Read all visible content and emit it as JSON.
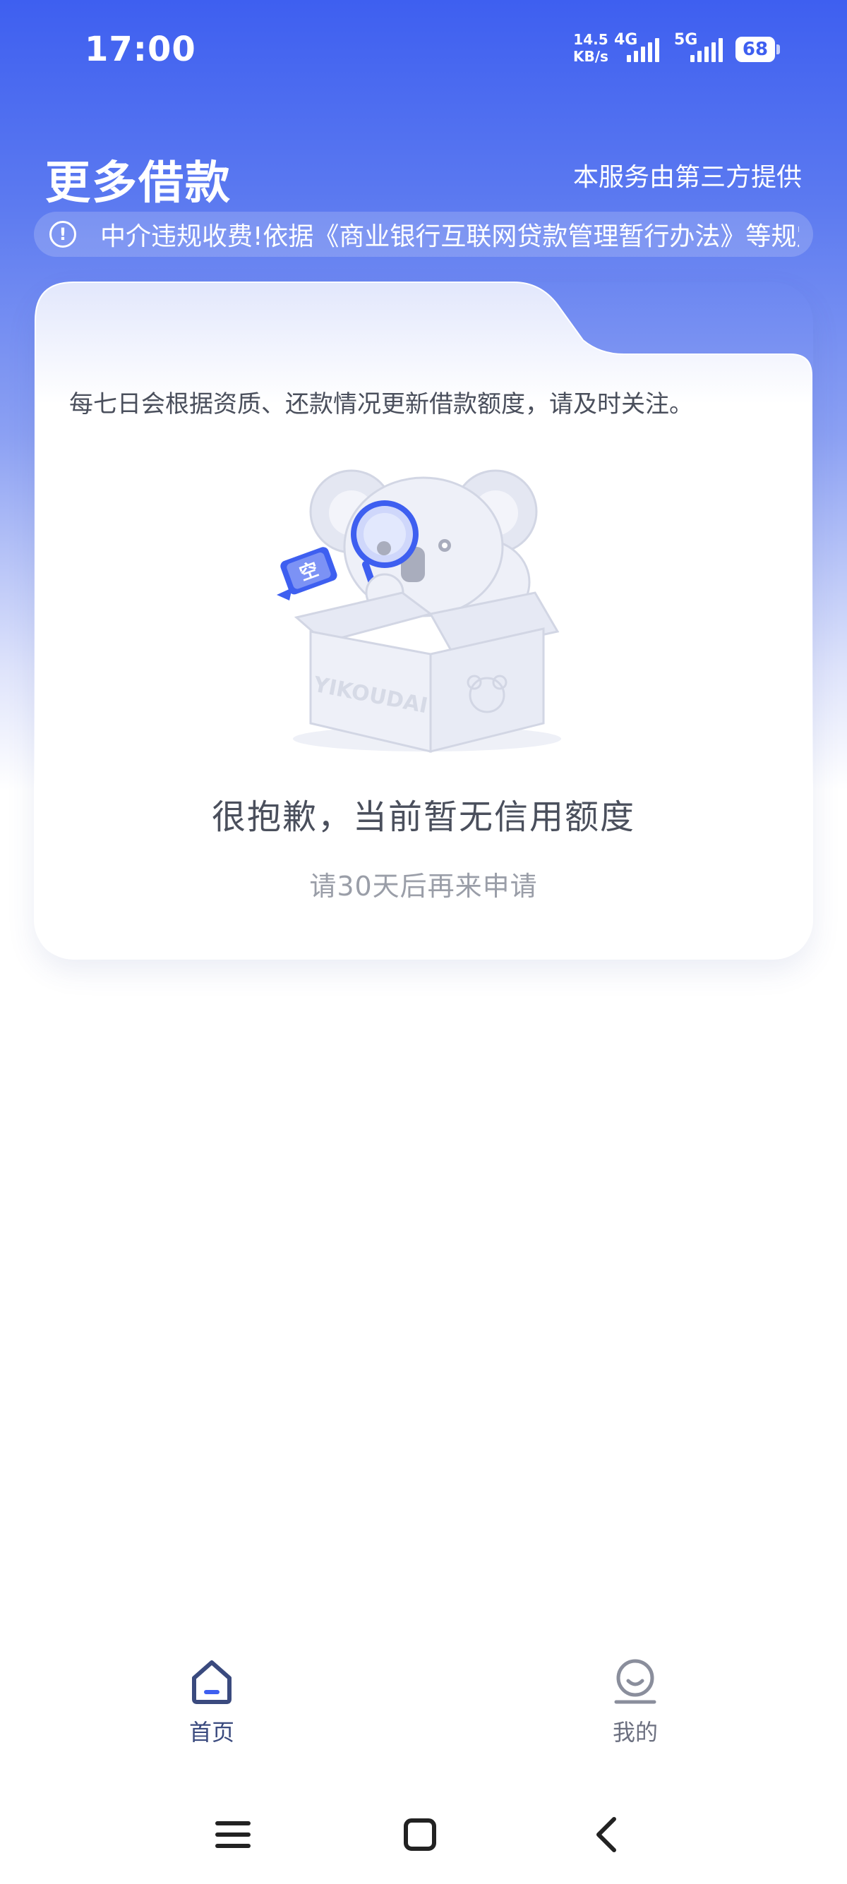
{
  "status_bar": {
    "time": "17:00",
    "net_speed_value": "14.5",
    "net_speed_unit": "KB/s",
    "network_type_1": "4G",
    "network_type_2": "5G",
    "battery_level": "68"
  },
  "header": {
    "title": "更多借款",
    "provider_note": "本服务由第三方提供"
  },
  "notice": {
    "icon": "info-icon",
    "text": "中介违规收费!依据《商业银行互联网贷款管理暂行办法》等规定"
  },
  "card": {
    "description": "每七日会根据资质、还款情况更新借款额度，请及时关注。",
    "illustration_box_text": "YIKOUDAI",
    "illustration_tag_text": "空",
    "empty_title": "很抱歉，当前暂无信用额度",
    "empty_subtitle": "请30天后再来申请"
  },
  "bottom_nav": {
    "items": [
      {
        "label": "首页",
        "icon": "home-icon",
        "active": true
      },
      {
        "label": "我的",
        "icon": "profile-icon",
        "active": false
      }
    ]
  },
  "system_nav": {
    "icons": [
      "menu-icon",
      "home-square-icon",
      "back-icon"
    ]
  },
  "colors": {
    "brand_blue": "#3e5ff0",
    "nav_active": "#3a4a7e",
    "nav_inactive": "#6c7080",
    "text_primary": "#4a4f5c",
    "text_secondary": "#9a9ea8"
  }
}
